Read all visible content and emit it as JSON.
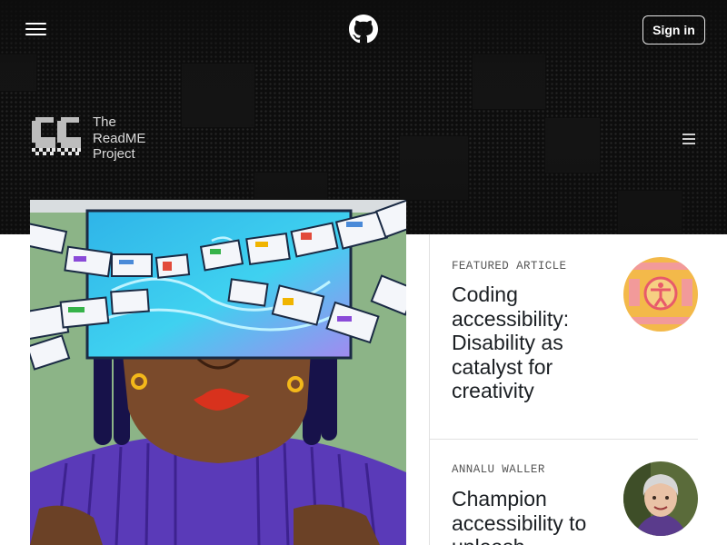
{
  "header": {
    "menu_icon": "hamburger-menu-icon",
    "logo_icon": "github-mark-icon",
    "signin_label": "Sign in"
  },
  "brand": {
    "logo_icon": "readme-quote-logo",
    "line1": "The",
    "line2": "ReadME",
    "line3": "Project",
    "menu_icon": "section-menu-icon"
  },
  "hero": {
    "image": "illustration-woman-with-screen-over-eyes"
  },
  "articles": [
    {
      "kicker": "FEATURED ARTICLE",
      "title": "Coding accessibility: Disability as catalyst for creativity",
      "thumb": "accessibility-symbol-thumbnail"
    },
    {
      "kicker": "ANNALU WALLER",
      "title": "Champion accessibility to unleash",
      "thumb": "annalu-waller-portrait"
    }
  ],
  "colors": {
    "header_bg": "#0d0d0d",
    "text_dark": "#1b1f23",
    "kicker": "#555555",
    "divider": "#e1e1e1"
  }
}
